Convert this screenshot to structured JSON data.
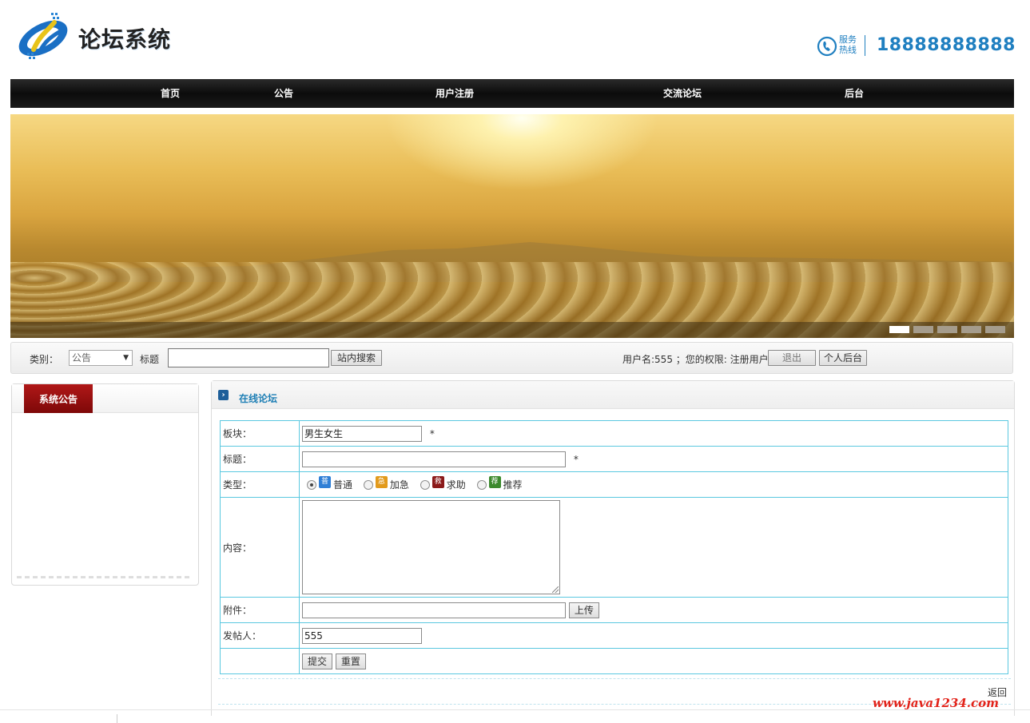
{
  "header": {
    "logo_text": "论坛系统",
    "hotline_label_1": "服务",
    "hotline_label_2": "热线",
    "hotline_number": "18888888888"
  },
  "nav": {
    "items": [
      {
        "label": "首页"
      },
      {
        "label": "公告"
      },
      {
        "label": "用户注册"
      },
      {
        "label": "交流论坛"
      },
      {
        "label": "后台"
      }
    ]
  },
  "banner": {
    "slide_count": 5,
    "active_slide": 1
  },
  "search": {
    "category_label": "类别：",
    "category_value": "公告",
    "title_label": "标题",
    "title_value": "",
    "search_button": "站内搜索",
    "user_info": "用户名:555 ；您的权限: 注册用户",
    "logout_button": "退出",
    "personal_button": "个人后台"
  },
  "sidebar": {
    "tab_title": "系统公告"
  },
  "main": {
    "title": "在线论坛",
    "form": {
      "board_label": "板块：",
      "board_value": "男生女生",
      "required_mark": "*",
      "title_label": "标题：",
      "title_value": "",
      "type_label": "类型：",
      "types": [
        {
          "badge": "普",
          "label": "普通",
          "color": "#2f7fd6",
          "checked": true
        },
        {
          "badge": "急",
          "label": "加急",
          "color": "#e29a1c",
          "checked": false
        },
        {
          "badge": "救",
          "label": "求助",
          "color": "#8b1a1a",
          "checked": false
        },
        {
          "badge": "荐",
          "label": "推荐",
          "color": "#3c8a2e",
          "checked": false
        }
      ],
      "content_label": "内容：",
      "content_value": "",
      "attachment_label": "附件：",
      "attachment_value": "",
      "upload_button": "上传",
      "poster_label": "发帖人：",
      "poster_value": "555",
      "submit_button": "提交",
      "reset_button": "重置"
    },
    "back_link": "返回"
  },
  "watermark": "www.java1234.com",
  "colors": {
    "accent_blue": "#1f7fc0",
    "table_border": "#5bc8e0",
    "tab_red": "#9e1010"
  }
}
